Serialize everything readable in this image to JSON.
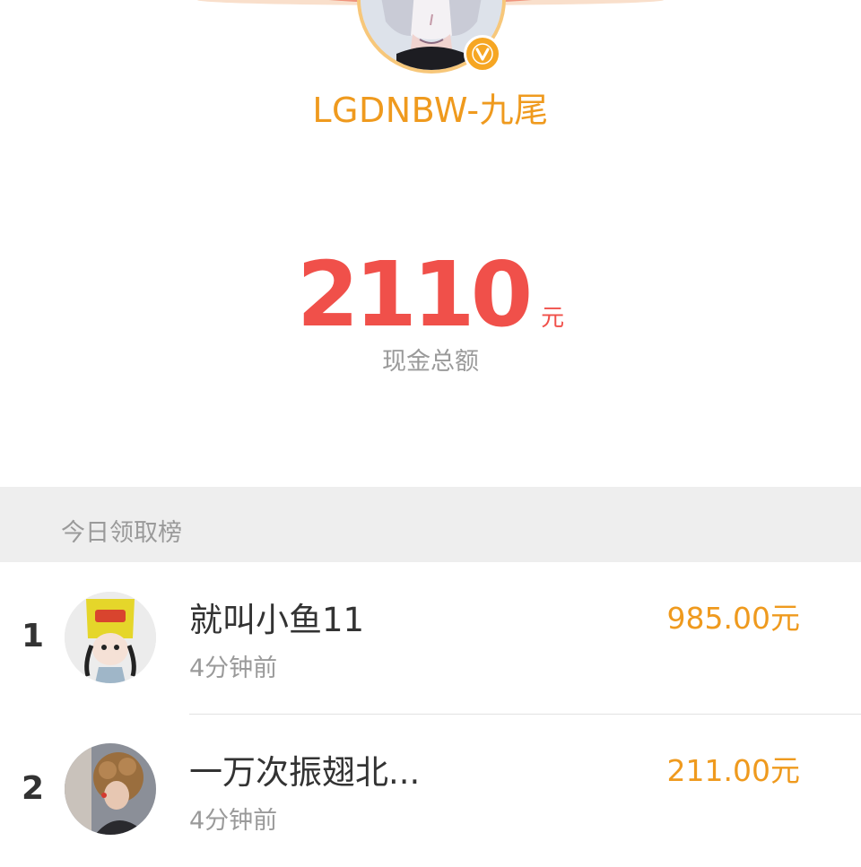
{
  "profile": {
    "username": "LGDNBW-九尾",
    "verified_badge_letter": "V"
  },
  "summary": {
    "amount": "2110",
    "unit": "元",
    "label": "现金总额"
  },
  "leaderboard": {
    "title": "今日领取榜",
    "rows": [
      {
        "rank": "1",
        "name": "就叫小鱼11",
        "time": "4分钟前",
        "amount": "985.00元",
        "avatar_icon": "chip-bag-hat-avatar"
      },
      {
        "rank": "2",
        "name": "一万次振翅北...",
        "time": "4分钟前",
        "amount": "211.00元",
        "avatar_icon": "curly-hair-avatar"
      }
    ]
  },
  "colors": {
    "accent_orange": "#ef9a1e",
    "amount_red": "#f0504a",
    "banner_red": "#e8413a",
    "section_gray": "#eeeeee"
  }
}
